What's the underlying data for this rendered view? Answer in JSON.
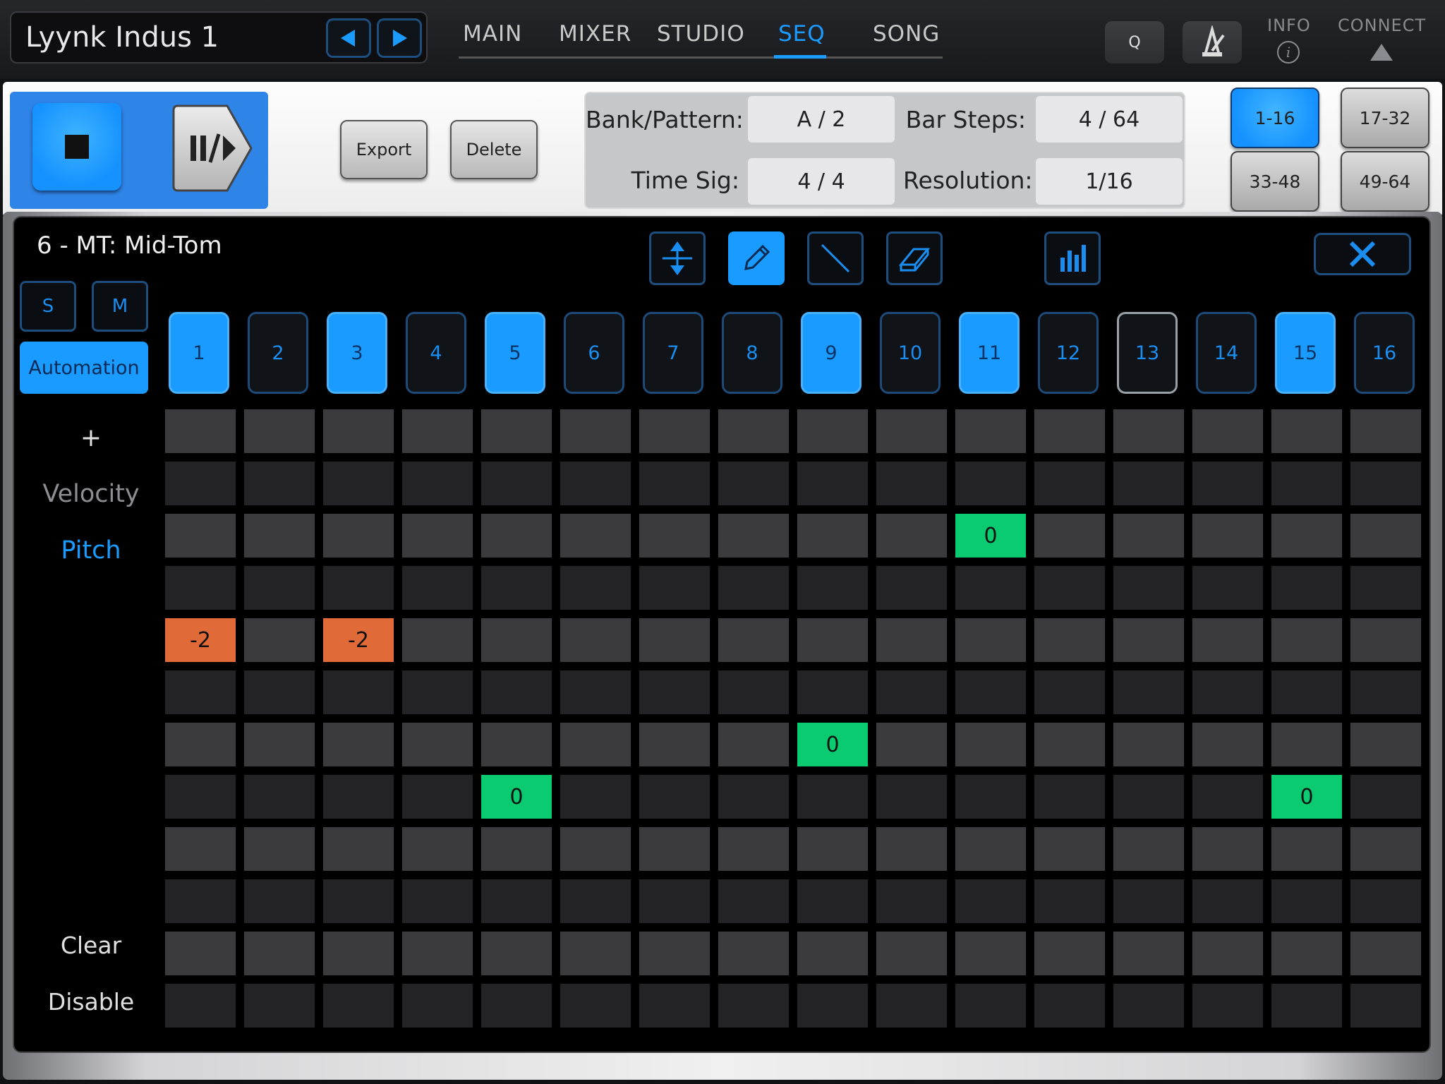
{
  "header": {
    "preset_name": "Lyynk Indus 1",
    "tabs": [
      {
        "label": "MAIN",
        "active": false
      },
      {
        "label": "MIXER",
        "active": false
      },
      {
        "label": "STUDIO",
        "active": false
      },
      {
        "label": "SEQ",
        "active": true
      },
      {
        "label": "SONG",
        "active": false
      }
    ],
    "quantize_label": "Q",
    "info_label": "INFO",
    "connect_label": "CONNECT"
  },
  "toolbar": {
    "export_label": "Export",
    "delete_label": "Delete",
    "bank_pattern_label": "Bank/Pattern:",
    "bank_pattern_value": "A / 2",
    "bar_steps_label": "Bar Steps:",
    "bar_steps_value": "4 / 64",
    "time_sig_label": "Time Sig:",
    "time_sig_value": "4 / 4",
    "resolution_label": "Resolution:",
    "resolution_value": "1/16",
    "ranges": [
      {
        "label": "1-16",
        "active": true
      },
      {
        "label": "17-32",
        "active": false
      },
      {
        "label": "33-48",
        "active": false
      },
      {
        "label": "49-64",
        "active": false
      }
    ]
  },
  "editor": {
    "track_title": "6 - MT: Mid-Tom",
    "solo_label": "S",
    "mute_label": "M",
    "automation_label": "Automation",
    "add_label": "+",
    "velocity_label": "Velocity",
    "pitch_label": "Pitch",
    "clear_label": "Clear",
    "disable_label": "Disable",
    "steps": [
      {
        "label": "1",
        "active": true
      },
      {
        "label": "2",
        "active": false
      },
      {
        "label": "3",
        "active": true
      },
      {
        "label": "4",
        "active": false
      },
      {
        "label": "5",
        "active": true
      },
      {
        "label": "6",
        "active": false
      },
      {
        "label": "7",
        "active": false
      },
      {
        "label": "8",
        "active": false
      },
      {
        "label": "9",
        "active": true
      },
      {
        "label": "10",
        "active": false
      },
      {
        "label": "11",
        "active": true
      },
      {
        "label": "12",
        "active": false
      },
      {
        "label": "13",
        "active": false,
        "cursor": true
      },
      {
        "label": "14",
        "active": false
      },
      {
        "label": "15",
        "active": true
      },
      {
        "label": "16",
        "active": false
      }
    ],
    "grid": {
      "rows": 12,
      "columns": 16,
      "notes": [
        {
          "row": 2,
          "col": 10,
          "value": "0",
          "color": "#0acb70"
        },
        {
          "row": 4,
          "col": 0,
          "value": "-2",
          "color": "#e06a38"
        },
        {
          "row": 4,
          "col": 2,
          "value": "-2",
          "color": "#e06a38"
        },
        {
          "row": 6,
          "col": 8,
          "value": "0",
          "color": "#0acb70"
        },
        {
          "row": 7,
          "col": 4,
          "value": "0",
          "color": "#0acb70"
        },
        {
          "row": 7,
          "col": 14,
          "value": "0",
          "color": "#0acb70"
        }
      ]
    }
  },
  "colors": {
    "accent": "#1a9bff",
    "positive_pitch": "#0acb70",
    "negative_pitch": "#e06a38"
  }
}
